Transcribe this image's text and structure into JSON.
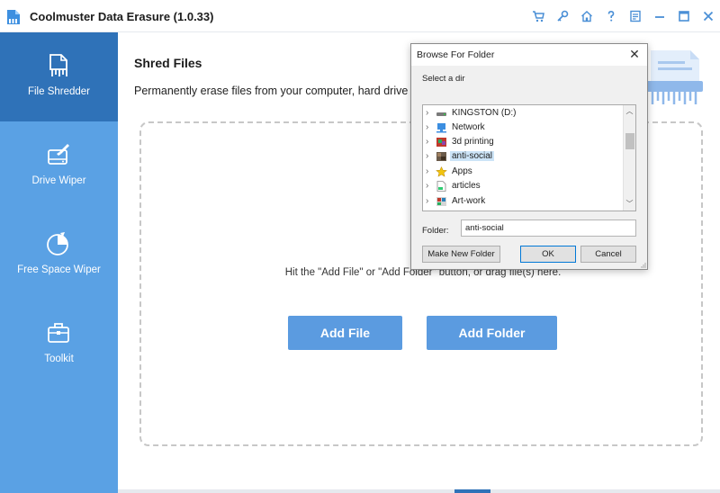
{
  "window": {
    "title": "Coolmuster Data Erasure (1.0.33)"
  },
  "titlebar_icons": [
    "cart-icon",
    "key-icon",
    "home-icon",
    "help-icon",
    "feedback-icon",
    "minimize-icon",
    "maximize-icon",
    "close-icon"
  ],
  "sidebar": {
    "items": [
      {
        "label": "File Shredder",
        "icon": "file-shredder-icon",
        "active": true
      },
      {
        "label": "Drive Wiper",
        "icon": "drive-wiper-icon",
        "active": false
      },
      {
        "label": "Free Space Wiper",
        "icon": "free-space-wiper-icon",
        "active": false
      },
      {
        "label": "Toolkit",
        "icon": "toolkit-icon",
        "active": false
      }
    ]
  },
  "main": {
    "title": "Shred Files",
    "description": "Permanently erase files from your computer, hard drive o",
    "hint": "Hit the \"Add File\" or \"Add Folder\" button, or drag file(s) here.",
    "add_file_label": "Add File",
    "add_folder_label": "Add Folder"
  },
  "dialog": {
    "title": "Browse For Folder",
    "prompt": "Select a dir",
    "tree": [
      {
        "label": "KINGSTON (D:)",
        "icon": "drive-icon",
        "selected": false
      },
      {
        "label": "Network",
        "icon": "network-icon",
        "selected": false
      },
      {
        "label": "3d printing",
        "icon": "image-folder-icon",
        "selected": false
      },
      {
        "label": "anti-social",
        "icon": "image-folder-icon",
        "selected": true
      },
      {
        "label": "Apps",
        "icon": "star-icon",
        "selected": false
      },
      {
        "label": "articles",
        "icon": "document-icon",
        "selected": false
      },
      {
        "label": "Art-work",
        "icon": "image-folder-icon",
        "selected": false
      }
    ],
    "folder_label": "Folder:",
    "folder_value": "anti-social",
    "buttons": {
      "new_folder": "Make New Folder",
      "ok": "OK",
      "cancel": "Cancel"
    }
  },
  "colors": {
    "sidebar": "#5aa1e4",
    "sidebar_active": "#2f72b8",
    "accent": "#5b9be0",
    "selection": "#cce4f7"
  }
}
